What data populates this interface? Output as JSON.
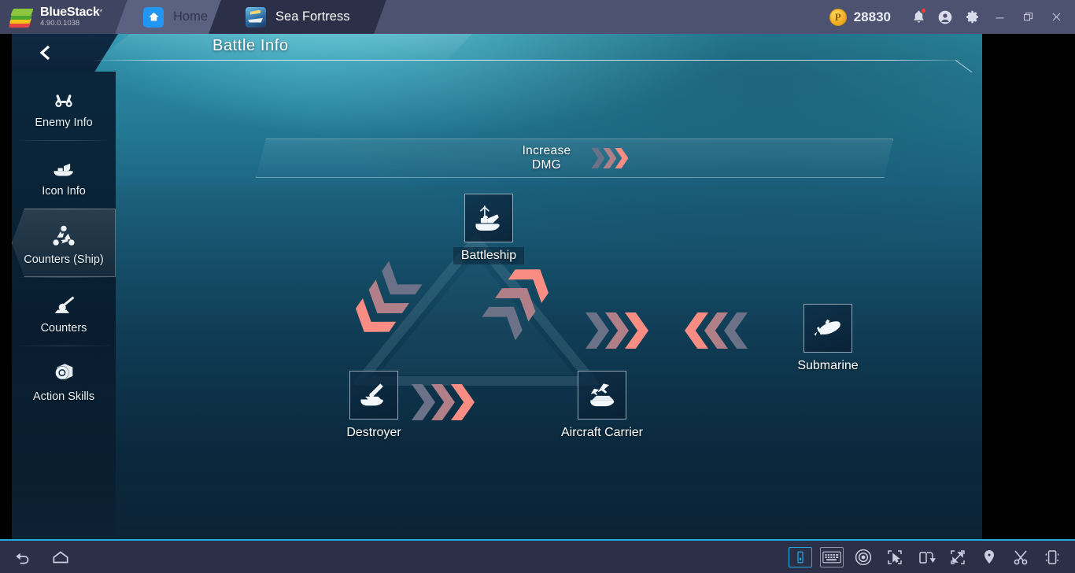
{
  "titlebar": {
    "brand_name": "BlueStacks",
    "version": "4.90.0.1038",
    "tabs": [
      {
        "label": "Home",
        "icon": "home-icon",
        "active": false
      },
      {
        "label": "Sea Fortress",
        "icon": "game-app-icon",
        "active": true
      }
    ],
    "coin_icon": "bluestacks-points-coin-icon",
    "coin_amount": "28830",
    "icons": [
      {
        "name": "notification-bell-icon",
        "badge": true
      },
      {
        "name": "account-avatar-icon",
        "badge": false
      },
      {
        "name": "settings-gear-icon",
        "badge": false
      }
    ],
    "window_controls": [
      {
        "name": "minimize-button",
        "glyph": "minimize"
      },
      {
        "name": "restore-button",
        "glyph": "restore"
      },
      {
        "name": "close-button",
        "glyph": "close"
      }
    ]
  },
  "game": {
    "header": {
      "back_icon": "back-chevron-icon",
      "title": "Battle Info"
    },
    "sidebar": {
      "items": [
        {
          "label": "Enemy Info",
          "icon": "binoculars-icon",
          "active": false
        },
        {
          "label": "Icon Info",
          "icon": "ship-hull-icon",
          "active": false
        },
        {
          "label": "Counters (Ship)",
          "icon": "counter-cycle-icon",
          "active": true
        },
        {
          "label": "Counters",
          "icon": "turret-gun-icon",
          "active": false
        },
        {
          "label": "Action Skills",
          "icon": "gear-cube-icon",
          "active": false
        }
      ]
    },
    "legend": {
      "line1": "Increase",
      "line2": "DMG",
      "chevron_colors": [
        "#6b7288",
        "#b07f87",
        "#f98d83"
      ]
    },
    "diagram": {
      "type": "counter-cycle",
      "nodes": [
        {
          "id": "battleship",
          "label": "Battleship",
          "icon": "battleship-icon"
        },
        {
          "id": "destroyer",
          "label": "Destroyer",
          "icon": "destroyer-icon"
        },
        {
          "id": "aircraft_carrier",
          "label": "Aircraft Carrier",
          "icon": "aircraft-carrier-icon"
        },
        {
          "id": "submarine",
          "label": "Submarine",
          "icon": "submarine-icon"
        }
      ],
      "relations": [
        {
          "from": "battleship",
          "to": "destroyer",
          "direction": "down-left"
        },
        {
          "from": "destroyer",
          "to": "aircraft_carrier",
          "direction": "right"
        },
        {
          "from": "aircraft_carrier",
          "to": "battleship",
          "direction": "up-right"
        },
        {
          "from": "aircraft_carrier",
          "to": "submarine",
          "direction": "right"
        },
        {
          "from": "submarine",
          "to": "aircraft_carrier",
          "direction": "left"
        }
      ]
    }
  },
  "bottombar": {
    "left_icons": [
      {
        "name": "back-arrow-icon"
      },
      {
        "name": "home-pentagon-icon"
      }
    ],
    "right_icons": [
      {
        "name": "app-window-icon",
        "selected": true
      },
      {
        "name": "keyboard-icon",
        "selected": false
      },
      {
        "name": "eye-target-icon",
        "selected": false
      },
      {
        "name": "cursor-select-icon",
        "selected": false
      },
      {
        "name": "rotate-screen-icon",
        "selected": false
      },
      {
        "name": "fullscreen-icon",
        "selected": false
      },
      {
        "name": "location-pin-icon",
        "selected": false
      },
      {
        "name": "scissors-screenshot-icon",
        "selected": false
      },
      {
        "name": "shake-device-icon",
        "selected": false
      }
    ]
  }
}
